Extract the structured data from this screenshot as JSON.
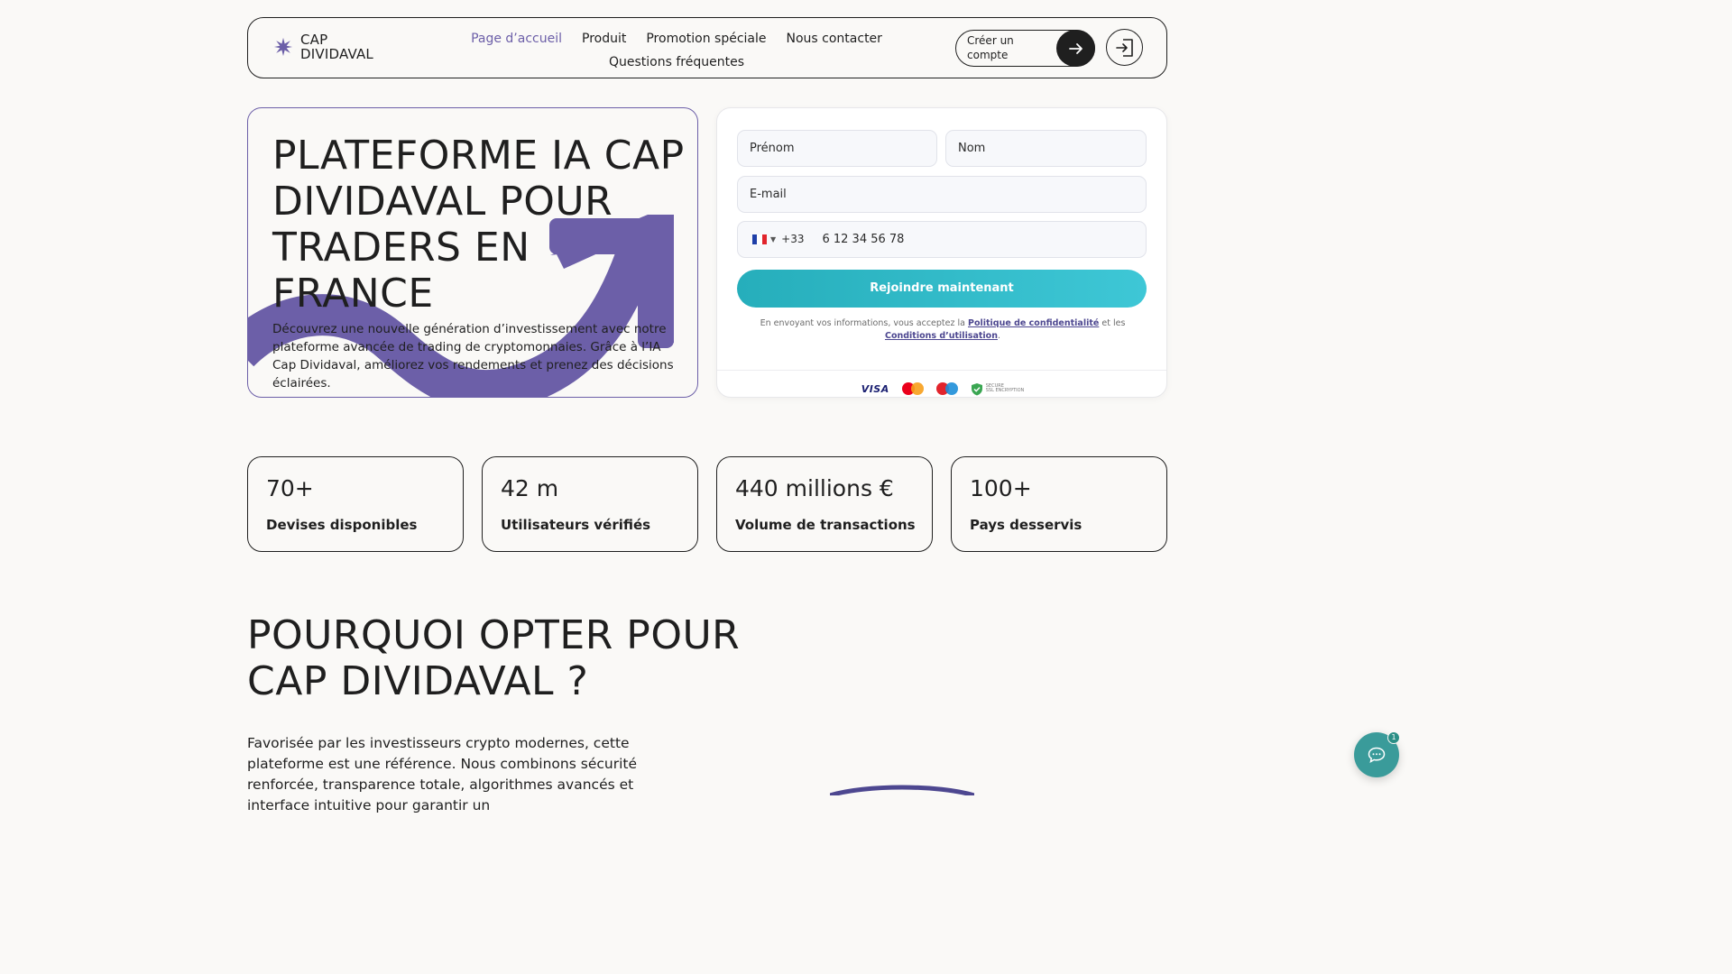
{
  "brand": {
    "line1": "CAP",
    "line2": "DIVIDAVAL",
    "accent": "#6c5fa8"
  },
  "nav": {
    "items": [
      "Page d’accueil",
      "Produit",
      "Promotion spéciale",
      "Nous contacter"
    ],
    "second_row": "Questions fréquentes",
    "active_index": 0
  },
  "header": {
    "create_account": "Créer un compte",
    "login_icon": "login-icon"
  },
  "hero": {
    "title": "PLATEFORME IA CAP DIVIDAVAL POUR TRADERS EN FRANCE",
    "description": "Découvrez une nouvelle génération d’investissement avec notre plateforme avancée de trading de cryptomonnaies. Grâce à l’IA Cap Dividaval, améliorez vos rendements et prenez des décisions éclairées."
  },
  "form": {
    "first_name_placeholder": "Prénom",
    "last_name_placeholder": "Nom",
    "email_placeholder": "E-mail",
    "dial_code": "+33",
    "phone_placeholder": "6 12 34 56 78",
    "submit_label": "Rejoindre maintenant",
    "submit_color": "#2fb8c6",
    "terms_prefix": "En envoyant vos informations, vous acceptez la",
    "privacy_link": "Politique de confidentialité",
    "terms_middle": "et les",
    "conditions_link": "Conditions d’utilisation",
    "terms_suffix": "."
  },
  "payments": {
    "visa": "VISA",
    "secure_line1": "SECURE",
    "secure_line2": "SSL ENCRYPTION"
  },
  "stats": [
    {
      "value": "70+",
      "label": "Devises disponibles"
    },
    {
      "value": "42 m",
      "label": "Utilisateurs vérifiés"
    },
    {
      "value": "440 millions €",
      "label": "Volume de transactions"
    },
    {
      "value": "100+",
      "label": "Pays desservis"
    }
  ],
  "why": {
    "title": "POURQUOI OPTER POUR CAP DIVIDAVAL ?",
    "text": "Favorisée par les investisseurs crypto modernes, cette plateforme est une référence. Nous combinons sécurité renforcée, transparence totale, algorithmes avancés et interface intuitive pour garantir un"
  },
  "chat": {
    "badge_count": "1"
  }
}
